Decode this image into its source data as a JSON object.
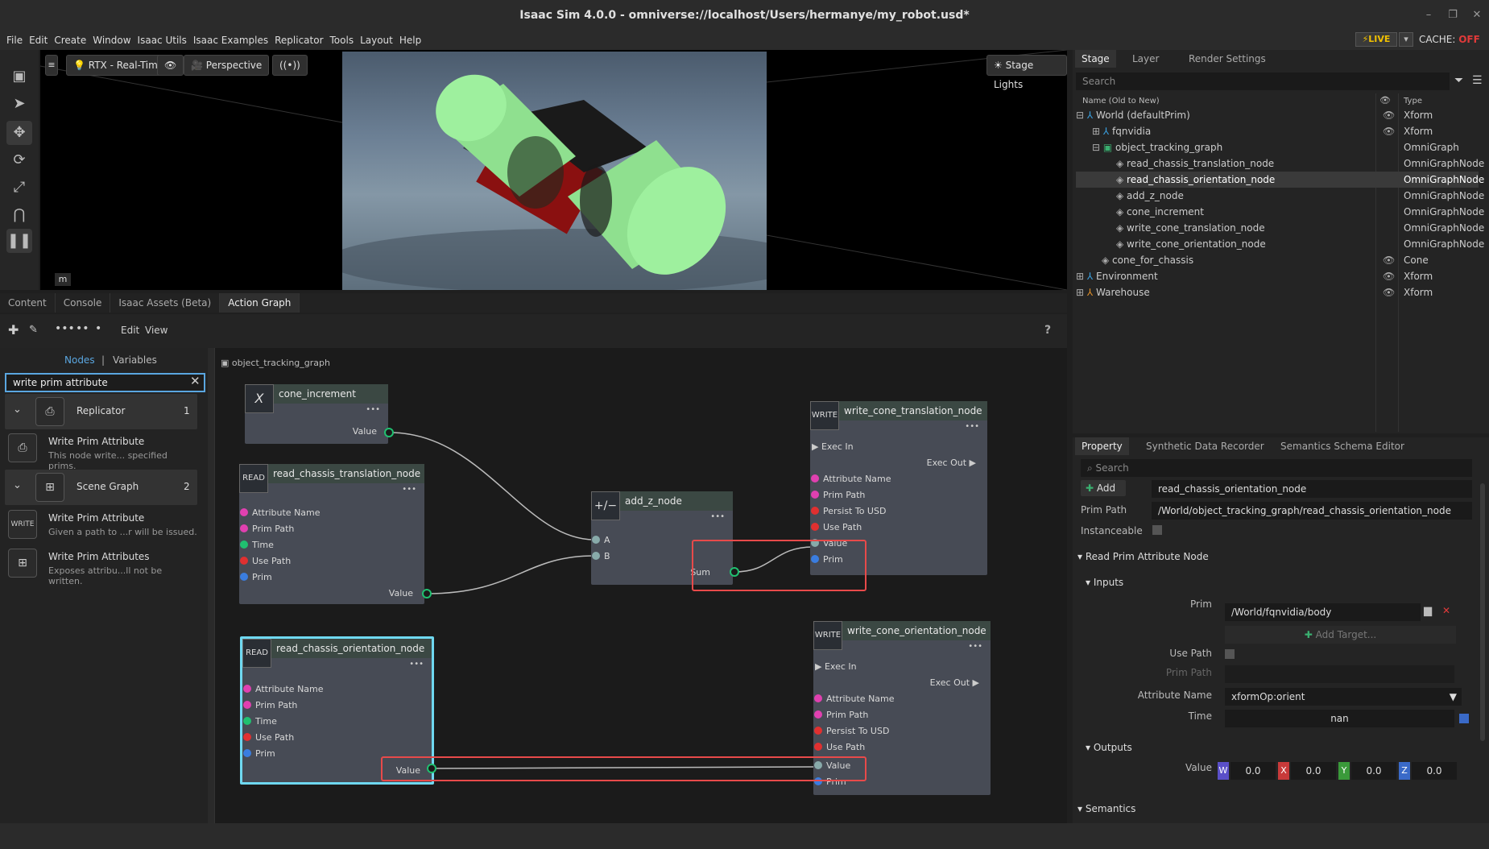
{
  "window": {
    "title": "Isaac Sim 4.0.0 - omniverse://localhost/Users/hermanye/my_robot.usd*",
    "controls": [
      "–",
      "❐",
      "✕"
    ]
  },
  "menu": [
    "File",
    "Edit",
    "Create",
    "Window",
    "Isaac Utils",
    "Isaac Examples",
    "Replicator",
    "Tools",
    "Layout",
    "Help"
  ],
  "status": {
    "live": "LIVE",
    "cache_label": "CACHE:",
    "cache_state": "OFF"
  },
  "viewport": {
    "renderer": "RTX - Real-Time",
    "camera": "Perspective",
    "stage_lights": "Stage Lights",
    "badge": "m"
  },
  "bottom_tabs": [
    "Content",
    "Console",
    "Isaac Assets (Beta)",
    "Action Graph"
  ],
  "action_graph": {
    "menu_edit": "Edit",
    "menu_view": "View",
    "help": "?",
    "nodes_tab": "Nodes",
    "vars_tab": "Variables",
    "search_value": "write prim attribute",
    "categories": [
      {
        "name": "Replicator",
        "count": "1"
      },
      {
        "name": "Scene Graph",
        "count": "2"
      }
    ],
    "results": [
      {
        "title": "Write Prim Attribute",
        "desc": "This node write... specified prims."
      },
      {
        "title": "Write Prim Attribute",
        "desc": "Given a path to ...r will be issued."
      },
      {
        "title": "Write Prim Attributes",
        "desc": "Exposes attribu...ll not be written."
      }
    ],
    "breadcrumb": "object_tracking_graph",
    "graph_nodes": {
      "cone_increment": {
        "title": "cone_increment",
        "icon": "X",
        "out": "Value"
      },
      "read_translation": {
        "title": "read_chassis_translation_node",
        "icon": "READ",
        "ports": [
          "Attribute Name",
          "Prim Path",
          "Time",
          "Use Path",
          "Prim"
        ],
        "out": "Value"
      },
      "read_orientation": {
        "title": "read_chassis_orientation_node",
        "icon": "READ",
        "ports": [
          "Attribute Name",
          "Prim Path",
          "Time",
          "Use Path",
          "Prim"
        ],
        "out": "Value"
      },
      "add_z": {
        "title": "add_z_node",
        "icon": "+/−",
        "a": "A",
        "b": "B",
        "sum": "Sum"
      },
      "write_translation": {
        "title": "write_cone_translation_node",
        "icon": "WRITE",
        "exec_in": "Exec In",
        "exec_out": "Exec Out",
        "ports": [
          "Attribute Name",
          "Prim Path",
          "Persist To USD",
          "Use Path",
          "Value",
          "Prim"
        ]
      },
      "write_orientation": {
        "title": "write_cone_orientation_node",
        "icon": "WRITE",
        "exec_in": "Exec In",
        "exec_out": "Exec Out",
        "ports": [
          "Attribute Name",
          "Prim Path",
          "Persist To USD",
          "Use Path",
          "Value",
          "Prim"
        ]
      }
    }
  },
  "stage": {
    "tabs": [
      "Stage",
      "Layer",
      "Render Settings"
    ],
    "search_placeholder": "Search",
    "col_name": "Name (Old to New)",
    "col_type": "Type",
    "rows": [
      {
        "name": "World (defaultPrim)",
        "type": "Xform"
      },
      {
        "name": "fqnvidia",
        "type": "Xform"
      },
      {
        "name": "object_tracking_graph",
        "type": "OmniGraph"
      },
      {
        "name": "read_chassis_translation_node",
        "type": "OmniGraphNode"
      },
      {
        "name": "read_chassis_orientation_node",
        "type": "OmniGraphNode"
      },
      {
        "name": "add_z_node",
        "type": "OmniGraphNode"
      },
      {
        "name": "cone_increment",
        "type": "OmniGraphNode"
      },
      {
        "name": "write_cone_translation_node",
        "type": "OmniGraphNode"
      },
      {
        "name": "write_cone_orientation_node",
        "type": "OmniGraphNode"
      },
      {
        "name": "cone_for_chassis",
        "type": "Cone"
      },
      {
        "name": "Environment",
        "type": "Xform"
      },
      {
        "name": "Warehouse",
        "type": "Xform"
      }
    ]
  },
  "property": {
    "tabs": [
      "Property",
      "Synthetic Data Recorder",
      "Semantics Schema Editor"
    ],
    "search_placeholder": "Search",
    "add": "Add",
    "name_value": "read_chassis_orientation_node",
    "prim_path_label": "Prim Path",
    "prim_path_value": "/World/object_tracking_graph/read_chassis_orientation_node",
    "instanceable_label": "Instanceable",
    "section_node": "Read Prim Attribute Node",
    "section_inputs": "Inputs",
    "prim_label": "Prim",
    "prim_value": "/World/fqnvidia/body",
    "add_target": "Add Target...",
    "use_path_label": "Use Path",
    "prim_path2_label": "Prim Path",
    "attr_name_label": "Attribute Name",
    "attr_name_value": "xformOp:orient",
    "time_label": "Time",
    "time_value": "nan",
    "section_outputs": "Outputs",
    "value_label": "Value",
    "value_components": [
      {
        "axis": "W",
        "value": "0.0",
        "color": "#5a4fc8"
      },
      {
        "axis": "X",
        "value": "0.0",
        "color": "#c83a3a"
      },
      {
        "axis": "Y",
        "value": "0.0",
        "color": "#3a9a3a"
      },
      {
        "axis": "Z",
        "value": "0.0",
        "color": "#3a6ac8"
      }
    ],
    "section_semantics": "Semantics"
  }
}
